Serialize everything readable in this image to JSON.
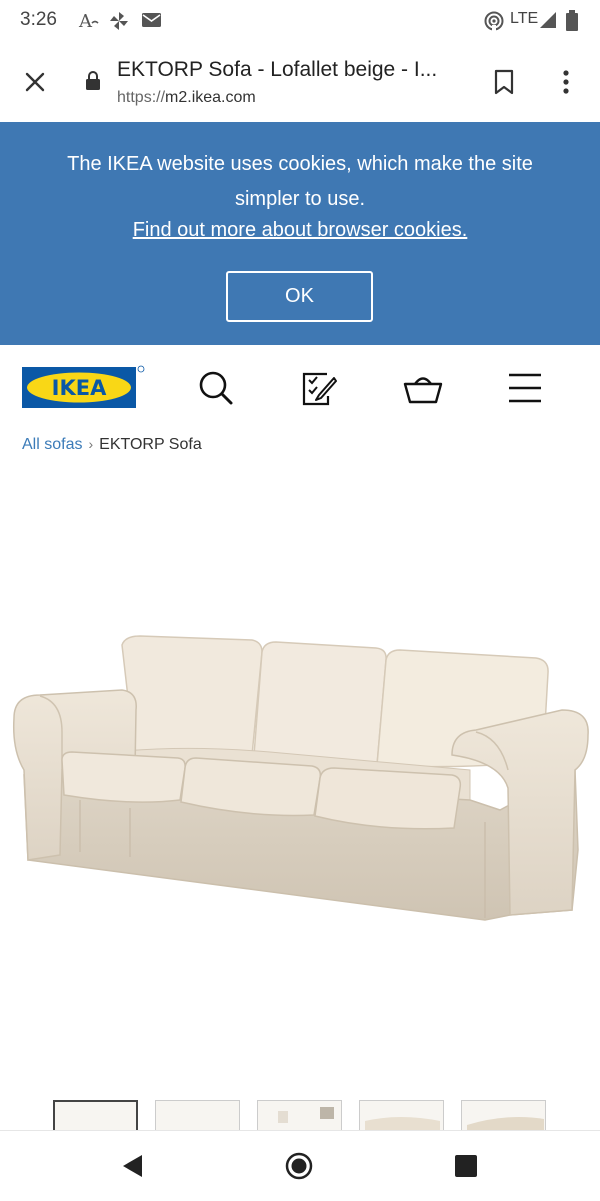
{
  "status_bar": {
    "time": "3:26",
    "network": "LTE",
    "icons": [
      "font-icon",
      "pinwheel-icon",
      "mail-icon",
      "hotspot-icon",
      "signal-icon",
      "battery-icon"
    ]
  },
  "browser": {
    "tab_title": "EKTORP Sofa - Lofallet beige - I...",
    "url_scheme": "https://",
    "url_domain": "m2.ikea.com"
  },
  "cookie_banner": {
    "message": "The IKEA website uses cookies, which make the site simpler to use.",
    "link": "Find out more about browser cookies.",
    "ok_label": "OK",
    "background": "#3f78b3"
  },
  "site_header": {
    "logo_text": "IKEA",
    "logo_colors": {
      "blue": "#0a58a6",
      "yellow": "#f9d716"
    },
    "icons": [
      "search-icon",
      "shopping-list-icon",
      "basket-icon",
      "menu-icon"
    ]
  },
  "breadcrumb": {
    "parent": "All sofas",
    "current": "EKTORP Sofa"
  },
  "gallery": {
    "thumbnail_count": 5,
    "selected": 1
  },
  "nav_bar": {
    "icons": [
      "back-icon",
      "home-icon",
      "recents-icon"
    ]
  }
}
